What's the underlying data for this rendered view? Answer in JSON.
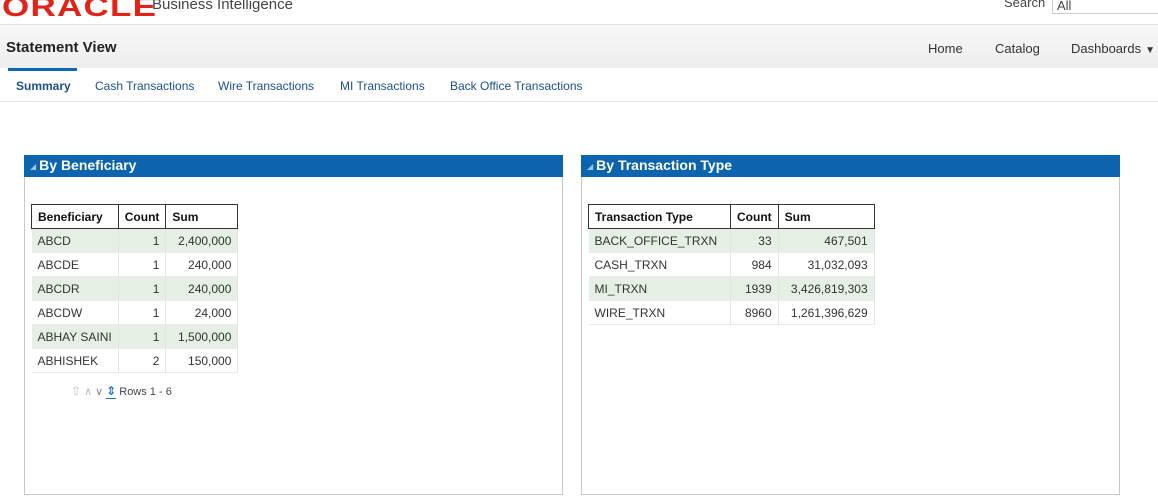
{
  "brand": {
    "logo": "ORACLE",
    "product": "Business Intelligence"
  },
  "search": {
    "label": "Search",
    "scope": "All"
  },
  "header": {
    "title": "Statement View",
    "nav": {
      "home": "Home",
      "catalog": "Catalog",
      "dashboards": "Dashboards"
    }
  },
  "tabs": [
    {
      "label": "Summary",
      "active": true
    },
    {
      "label": "Cash Transactions"
    },
    {
      "label": "Wire Transactions"
    },
    {
      "label": "MI Transactions"
    },
    {
      "label": "Back Office Transactions"
    }
  ],
  "beneficiary_panel": {
    "title": "By Beneficiary",
    "columns": [
      "Beneficiary",
      "Count",
      "Sum"
    ],
    "rows": [
      [
        "ABCD",
        "1",
        "2,400,000"
      ],
      [
        "ABCDE",
        "1",
        "240,000"
      ],
      [
        "ABCDR",
        "1",
        "240,000"
      ],
      [
        "ABCDW",
        "1",
        "24,000"
      ],
      [
        "ABHAY SAINI",
        "1",
        "1,500,000"
      ],
      [
        "ABHISHEK",
        "2",
        "150,000"
      ]
    ],
    "pager": {
      "rows_label": "Rows 1 - 6"
    }
  },
  "transaction_panel": {
    "title": "By Transaction Type",
    "columns": [
      "Transaction Type",
      "Count",
      "Sum"
    ],
    "rows": [
      [
        "BACK_OFFICE_TRXN",
        "33",
        "467,501"
      ],
      [
        "CASH_TRXN",
        "984",
        "31,032,093"
      ],
      [
        "MI_TRXN",
        "1939",
        "3,426,819,303"
      ],
      [
        "WIRE_TRXN",
        "8960",
        "1,261,396,629"
      ]
    ]
  },
  "colors": {
    "brand_red": "#e2231a",
    "panel_header_blue": "#0c63ae",
    "row_band_green": "#e5efe5",
    "link_blue": "#1d4f8c"
  }
}
